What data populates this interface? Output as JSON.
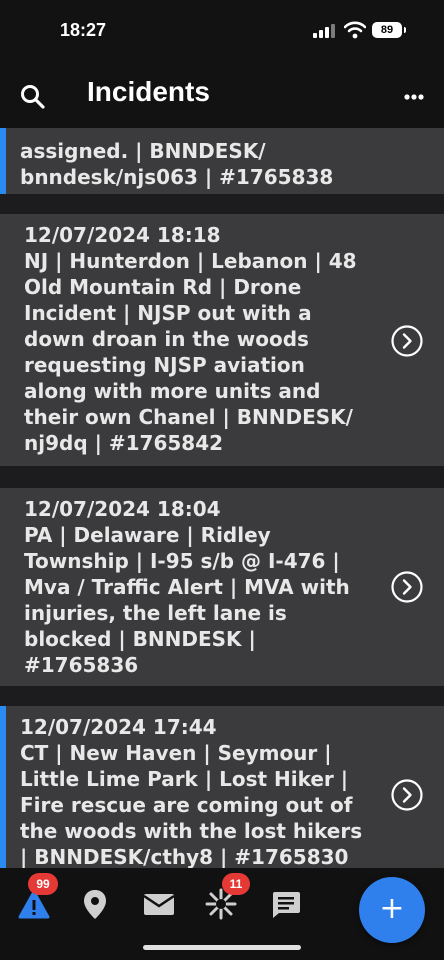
{
  "status_bar": {
    "time": "18:27",
    "battery": "89"
  },
  "header": {
    "title": "Incidents"
  },
  "incidents": [
    {
      "timestamp": "",
      "text": "assigned.  | BNNDESK/ bnndesk/njs063 | #1765838"
    },
    {
      "timestamp": "12/07/2024 18:18",
      "text": "NJ | Hunterdon | Lebanon | 48 Old Mountain Rd | Drone Incident | NJSP out with a down droan in the woods requesting NJSP aviation along with more units and their own Chanel | BNNDESK/ nj9dq | #1765842"
    },
    {
      "timestamp": "12/07/2024 18:04",
      "text": "PA | Delaware | Ridley Township | I-95 s/b @ I-476  | Mva / Traffic Alert | MVA with injuries, the left lane is blocked  | BNNDESK | #1765836"
    },
    {
      "timestamp": "12/07/2024 17:44",
      "text": "CT | New Haven | Seymour | Little Lime Park  | Lost Hiker | Fire rescue are coming out of the woods with the lost hikers | BNNDESK/cthy8 | #1765830"
    }
  ],
  "nav": {
    "alerts_badge": "99",
    "scanner_badge": "11",
    "fab_label": "+"
  },
  "colors": {
    "accent": "#2a8cf2",
    "badge": "#e53935",
    "fab": "#2f80ed",
    "card": "#3b3b3d"
  }
}
